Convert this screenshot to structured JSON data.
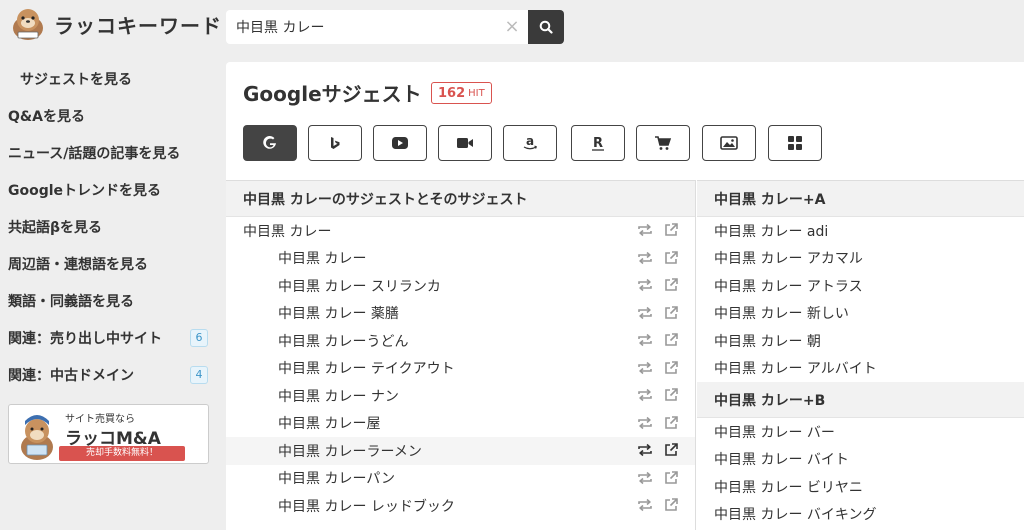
{
  "header": {
    "logo_text": "ラッコキーワード",
    "search_value": "中目黒 カレー",
    "clear_glyph": "×",
    "search_icon": "search-icon"
  },
  "sidebar": {
    "items": [
      {
        "label": "サジェストを見る",
        "badge": ""
      },
      {
        "label": "Q&Aを見る",
        "badge": ""
      },
      {
        "label": "ニュース/話題の記事を見る",
        "badge": ""
      },
      {
        "label": "Googleトレンドを見る",
        "badge": ""
      },
      {
        "label": "共起語βを見る",
        "badge": ""
      },
      {
        "label": "周辺語・連想語を見る",
        "badge": ""
      },
      {
        "label": "類語・同義語を見る",
        "badge": ""
      },
      {
        "label": "関連：売り出し中サイト",
        "badge": "6"
      },
      {
        "label": "関連：中古ドメイン",
        "badge": "4"
      }
    ],
    "banner": {
      "small": "サイト売買なら",
      "big": "ラッコM&A",
      "tag": "売却手数料無料！"
    }
  },
  "main": {
    "title": "Googleサジェスト",
    "hit_count": "162",
    "hit_label": "HIT",
    "tools": [
      "google-icon",
      "bing-icon",
      "youtube-icon",
      "video-icon",
      "amazon-icon",
      "rakuten-icon",
      "cart-icon",
      "image-icon",
      "apps-icon"
    ],
    "left": {
      "heading": "中目黒 カレーのサジェストとそのサジェスト",
      "parent": "中目黒 カレー",
      "children": [
        "中目黒 カレー",
        "中目黒 カレー スリランカ",
        "中目黒 カレー 薬膳",
        "中目黒 カレーうどん",
        "中目黒 カレー テイクアウト",
        "中目黒 カレー ナン",
        "中目黒 カレー屋",
        "中目黒 カレーラーメン",
        "中目黒 カレーパン",
        "中目黒 カレー レッドブック"
      ]
    },
    "right": {
      "groups": [
        {
          "heading": "中目黒 カレー+A",
          "items": [
            "中目黒 カレー adi",
            "中目黒 カレー アカマル",
            "中目黒 カレー アトラス",
            "中目黒 カレー 新しい",
            "中目黒 カレー 朝",
            "中目黒 カレー アルバイト"
          ]
        },
        {
          "heading": "中目黒 カレー+B",
          "items": [
            "中目黒 カレー バー",
            "中目黒 カレー バイト",
            "中目黒 カレー ビリヤニ",
            "中目黒 カレー バイキング"
          ]
        }
      ]
    }
  },
  "colors": {
    "accent": "#d9534f",
    "dark": "#444444",
    "badge": "#3d95c8"
  }
}
